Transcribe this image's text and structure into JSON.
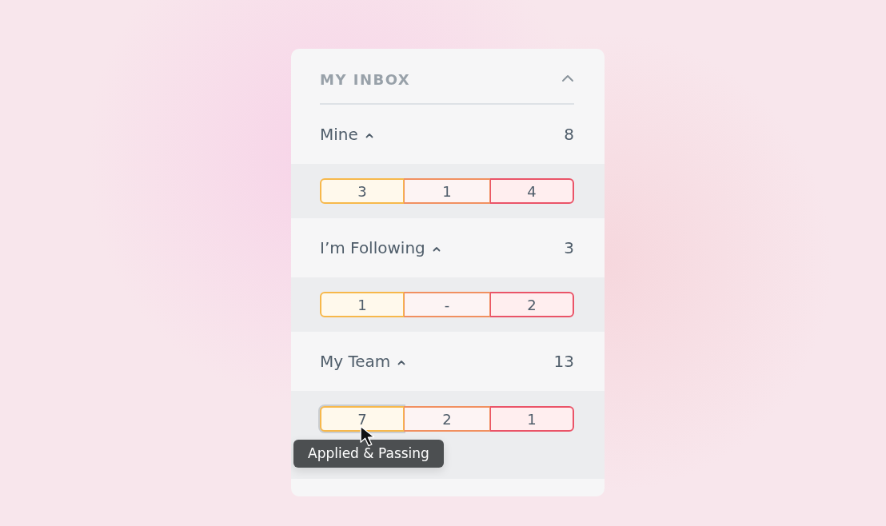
{
  "panel": {
    "title": "MY INBOX",
    "expanded": true,
    "sections": [
      {
        "label": "Mine",
        "expanded": true,
        "count": "8",
        "segments": [
          {
            "kind": "passing",
            "value": "3",
            "focused": false
          },
          {
            "kind": "warning",
            "value": "1",
            "focused": false
          },
          {
            "kind": "failing",
            "value": "4",
            "focused": false
          }
        ]
      },
      {
        "label": "I’m Following",
        "expanded": true,
        "count": "3",
        "segments": [
          {
            "kind": "passing",
            "value": "1",
            "focused": false
          },
          {
            "kind": "warning",
            "value": "-",
            "focused": false
          },
          {
            "kind": "failing",
            "value": "2",
            "focused": false
          }
        ]
      },
      {
        "label": "My Team",
        "expanded": true,
        "count": "13",
        "segments": [
          {
            "kind": "passing",
            "value": "7",
            "focused": true
          },
          {
            "kind": "warning",
            "value": "2",
            "focused": false
          },
          {
            "kind": "failing",
            "value": "1",
            "focused": false
          }
        ],
        "tooltip": "Applied & Passing"
      }
    ]
  }
}
